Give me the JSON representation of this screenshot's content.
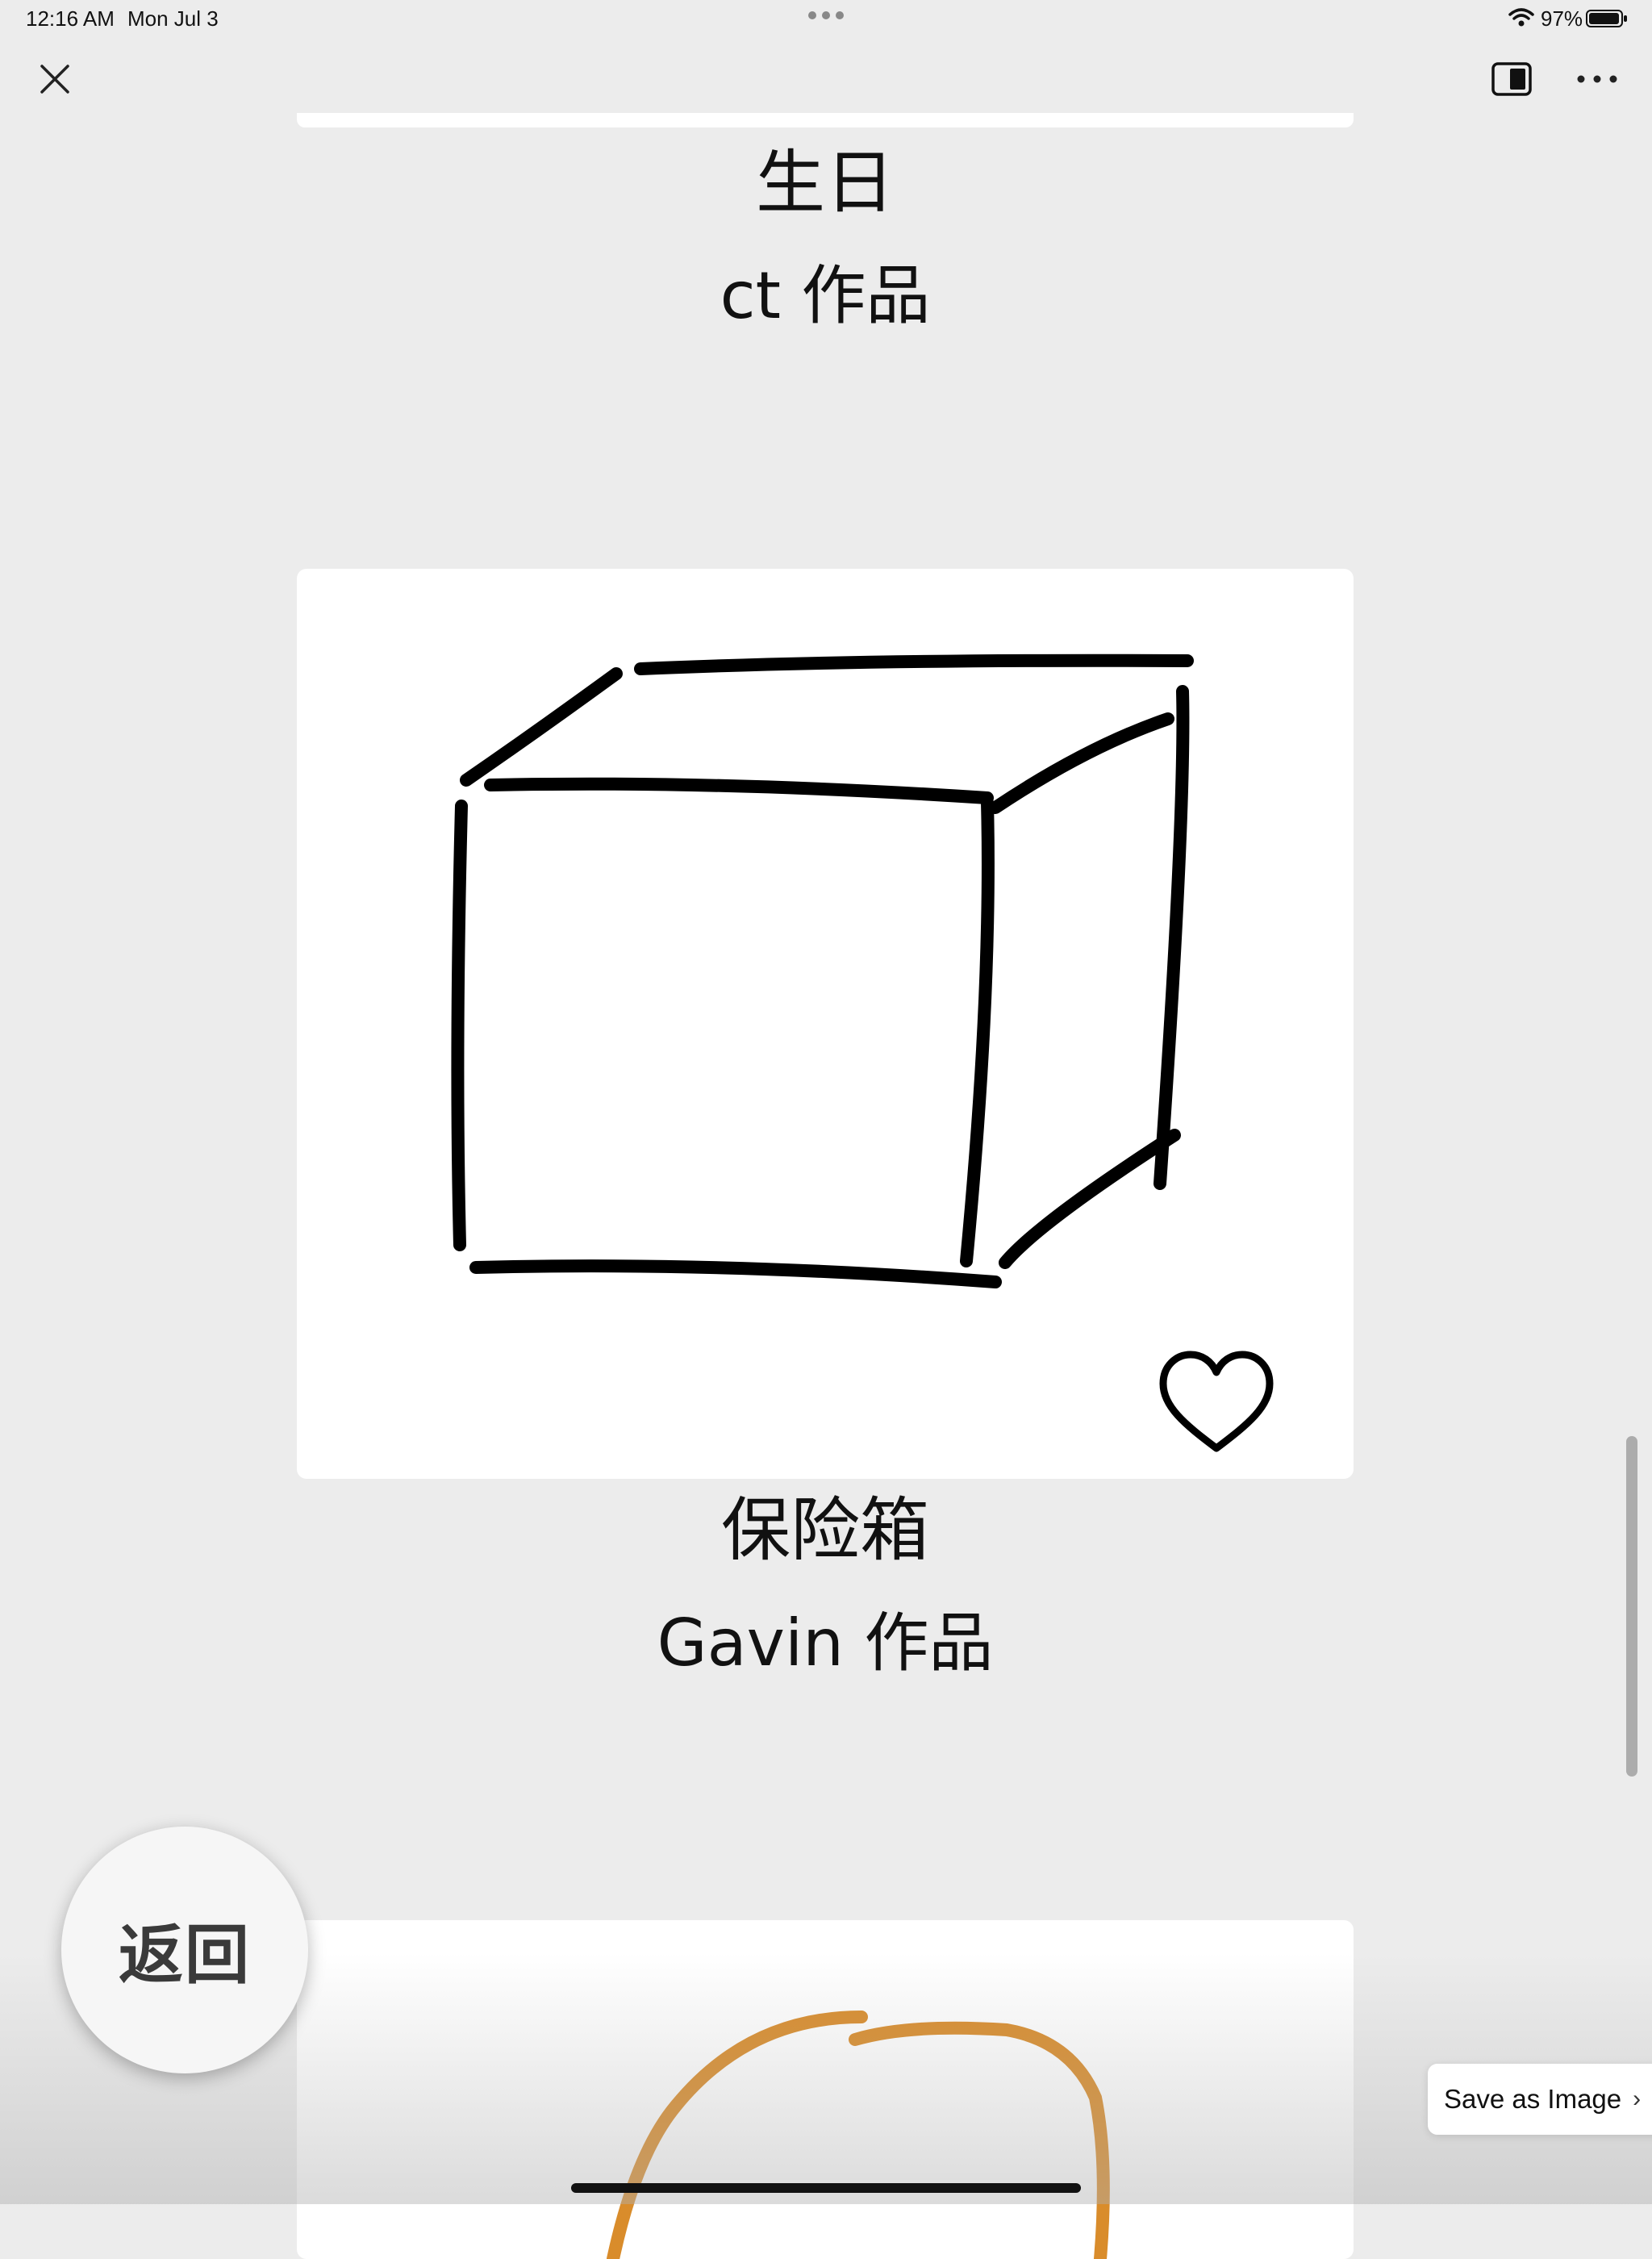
{
  "status_bar": {
    "time": "12:16 AM",
    "date": "Mon Jul 3",
    "battery": "97%"
  },
  "toolbar": {
    "close_icon": "close-icon",
    "split_icon": "split-view-icon",
    "more_icon": "more-horizontal-icon"
  },
  "artworks": [
    {
      "title": "生日",
      "author": "ct 作品"
    },
    {
      "title": "保险箱",
      "author": "Gavin 作品",
      "liked_icon": "heart-outline-icon"
    },
    {
      "stroke_color": "#d98c2b"
    }
  ],
  "back_button": {
    "label": "返回"
  },
  "save_image": {
    "label": "Save as Image",
    "chevron": "›"
  },
  "colors": {
    "background": "#ececec",
    "card": "#ffffff",
    "ink": "#000000",
    "orange_stroke": "#d98c2b"
  }
}
